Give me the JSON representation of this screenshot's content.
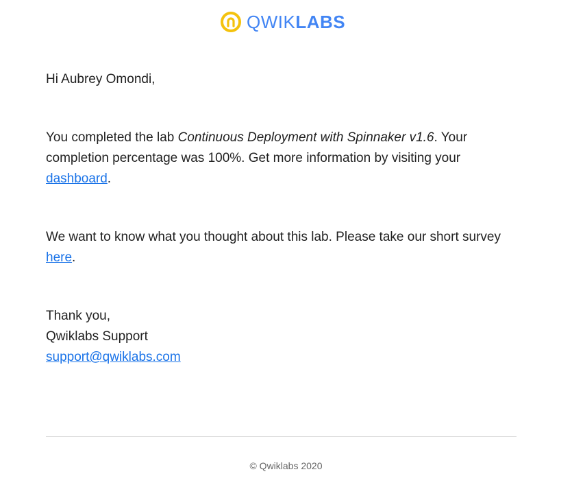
{
  "header": {
    "logo_icon": "qwiklabs-logo-icon",
    "logo_text_light": "QWIK",
    "logo_text_bold": "LABS",
    "brand_colors": {
      "logo_yellow": "#f4c20d",
      "logo_blue": "#4285f4"
    }
  },
  "email": {
    "greeting": "Hi Aubrey Omondi,",
    "completion": {
      "prefix": "You completed the lab ",
      "lab_name": "Continuous Deployment with Spinnaker v1.6",
      "middle": ". Your completion percentage was 100%. Get more information by visiting your ",
      "dashboard_link": "dashboard",
      "suffix": "."
    },
    "survey": {
      "prefix": "We want to know what you thought about this lab. Please take our short survey ",
      "link": "here",
      "suffix": "."
    },
    "signoff": {
      "thanks": "Thank you,",
      "sender": "Qwiklabs Support",
      "email_link": "support@qwiklabs.com"
    },
    "link_color": "#1a73e8"
  },
  "footer": {
    "copyright": "© Qwiklabs 2020"
  }
}
